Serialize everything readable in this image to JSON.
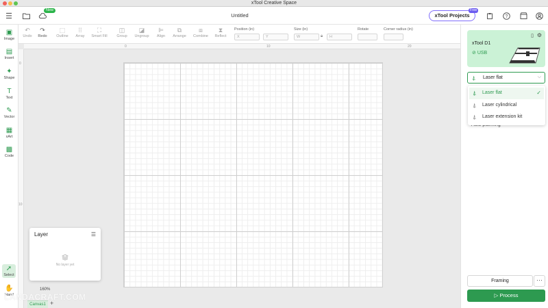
{
  "window": {
    "title": "xTool Creative Space"
  },
  "colors": {
    "accent": "#2d9a50",
    "project_border": "#7f6dfb",
    "free_badge": "#6c5cf0",
    "device_card": "#cbf2d6"
  },
  "header": {
    "menu_icon": "sidebar-menu-icon",
    "folder_icon": "folder-icon",
    "cloud_icon": "cloud-icon",
    "new_badge": "New",
    "doc_title": "Untitled",
    "projects_label": "xTool Projects",
    "free_badge": "Free",
    "right_icons": [
      "clipboard-icon",
      "help-icon",
      "store-icon",
      "user-icon"
    ]
  },
  "left_toolbar": [
    {
      "label": "Image",
      "icon": "image-icon"
    },
    {
      "label": "Insert",
      "icon": "insert-icon"
    },
    {
      "label": "Shape",
      "icon": "shape-icon"
    },
    {
      "label": "Text",
      "icon": "text-icon"
    },
    {
      "label": "Vector",
      "icon": "pen-icon"
    },
    {
      "label": "xArt",
      "icon": "xart-icon"
    },
    {
      "label": "Code",
      "icon": "qrcode-icon"
    },
    {
      "label": "Select",
      "icon": "select-arrow-icon"
    },
    {
      "label": "Hand",
      "icon": "hand-icon"
    }
  ],
  "top_toolbar": {
    "tools": [
      "Undo",
      "Redo",
      "Outline",
      "Array",
      "Smart Fill",
      "Group",
      "Ungroup",
      "Align",
      "Arrange",
      "Combine",
      "Reflect"
    ],
    "position_label": "Position (in)",
    "x_placeholder": "X",
    "y_placeholder": "Y",
    "size_label": "Size (in)",
    "w_placeholder": "W",
    "h_placeholder": "H",
    "rotate_label": "Rotate",
    "corner_label": "Corner radius (in)"
  },
  "canvas": {
    "ruler_marks": [
      "0",
      "10",
      "20",
      "0",
      "10"
    ],
    "zoom": "160%",
    "tab_label": "Canvas1",
    "add_tab": "+"
  },
  "layer_panel": {
    "title": "Layer",
    "settings_icon": "layer-settings-icon",
    "empty_icon": "layers-empty-icon",
    "empty_text": "No layer yet"
  },
  "device": {
    "name": "xTool D1",
    "connection": "USB",
    "icons": [
      "save-icon",
      "settings-icon"
    ]
  },
  "processing": {
    "mode_selected": "Laser flat",
    "options": [
      "Laser flat",
      "Laser cylindrical",
      "Laser extension kit"
    ],
    "auto_planning": "Auto planning",
    "framing_label": "Framing",
    "more_label": "···",
    "process_label": "Process"
  },
  "watermark": "LANDACRAFT.COM"
}
